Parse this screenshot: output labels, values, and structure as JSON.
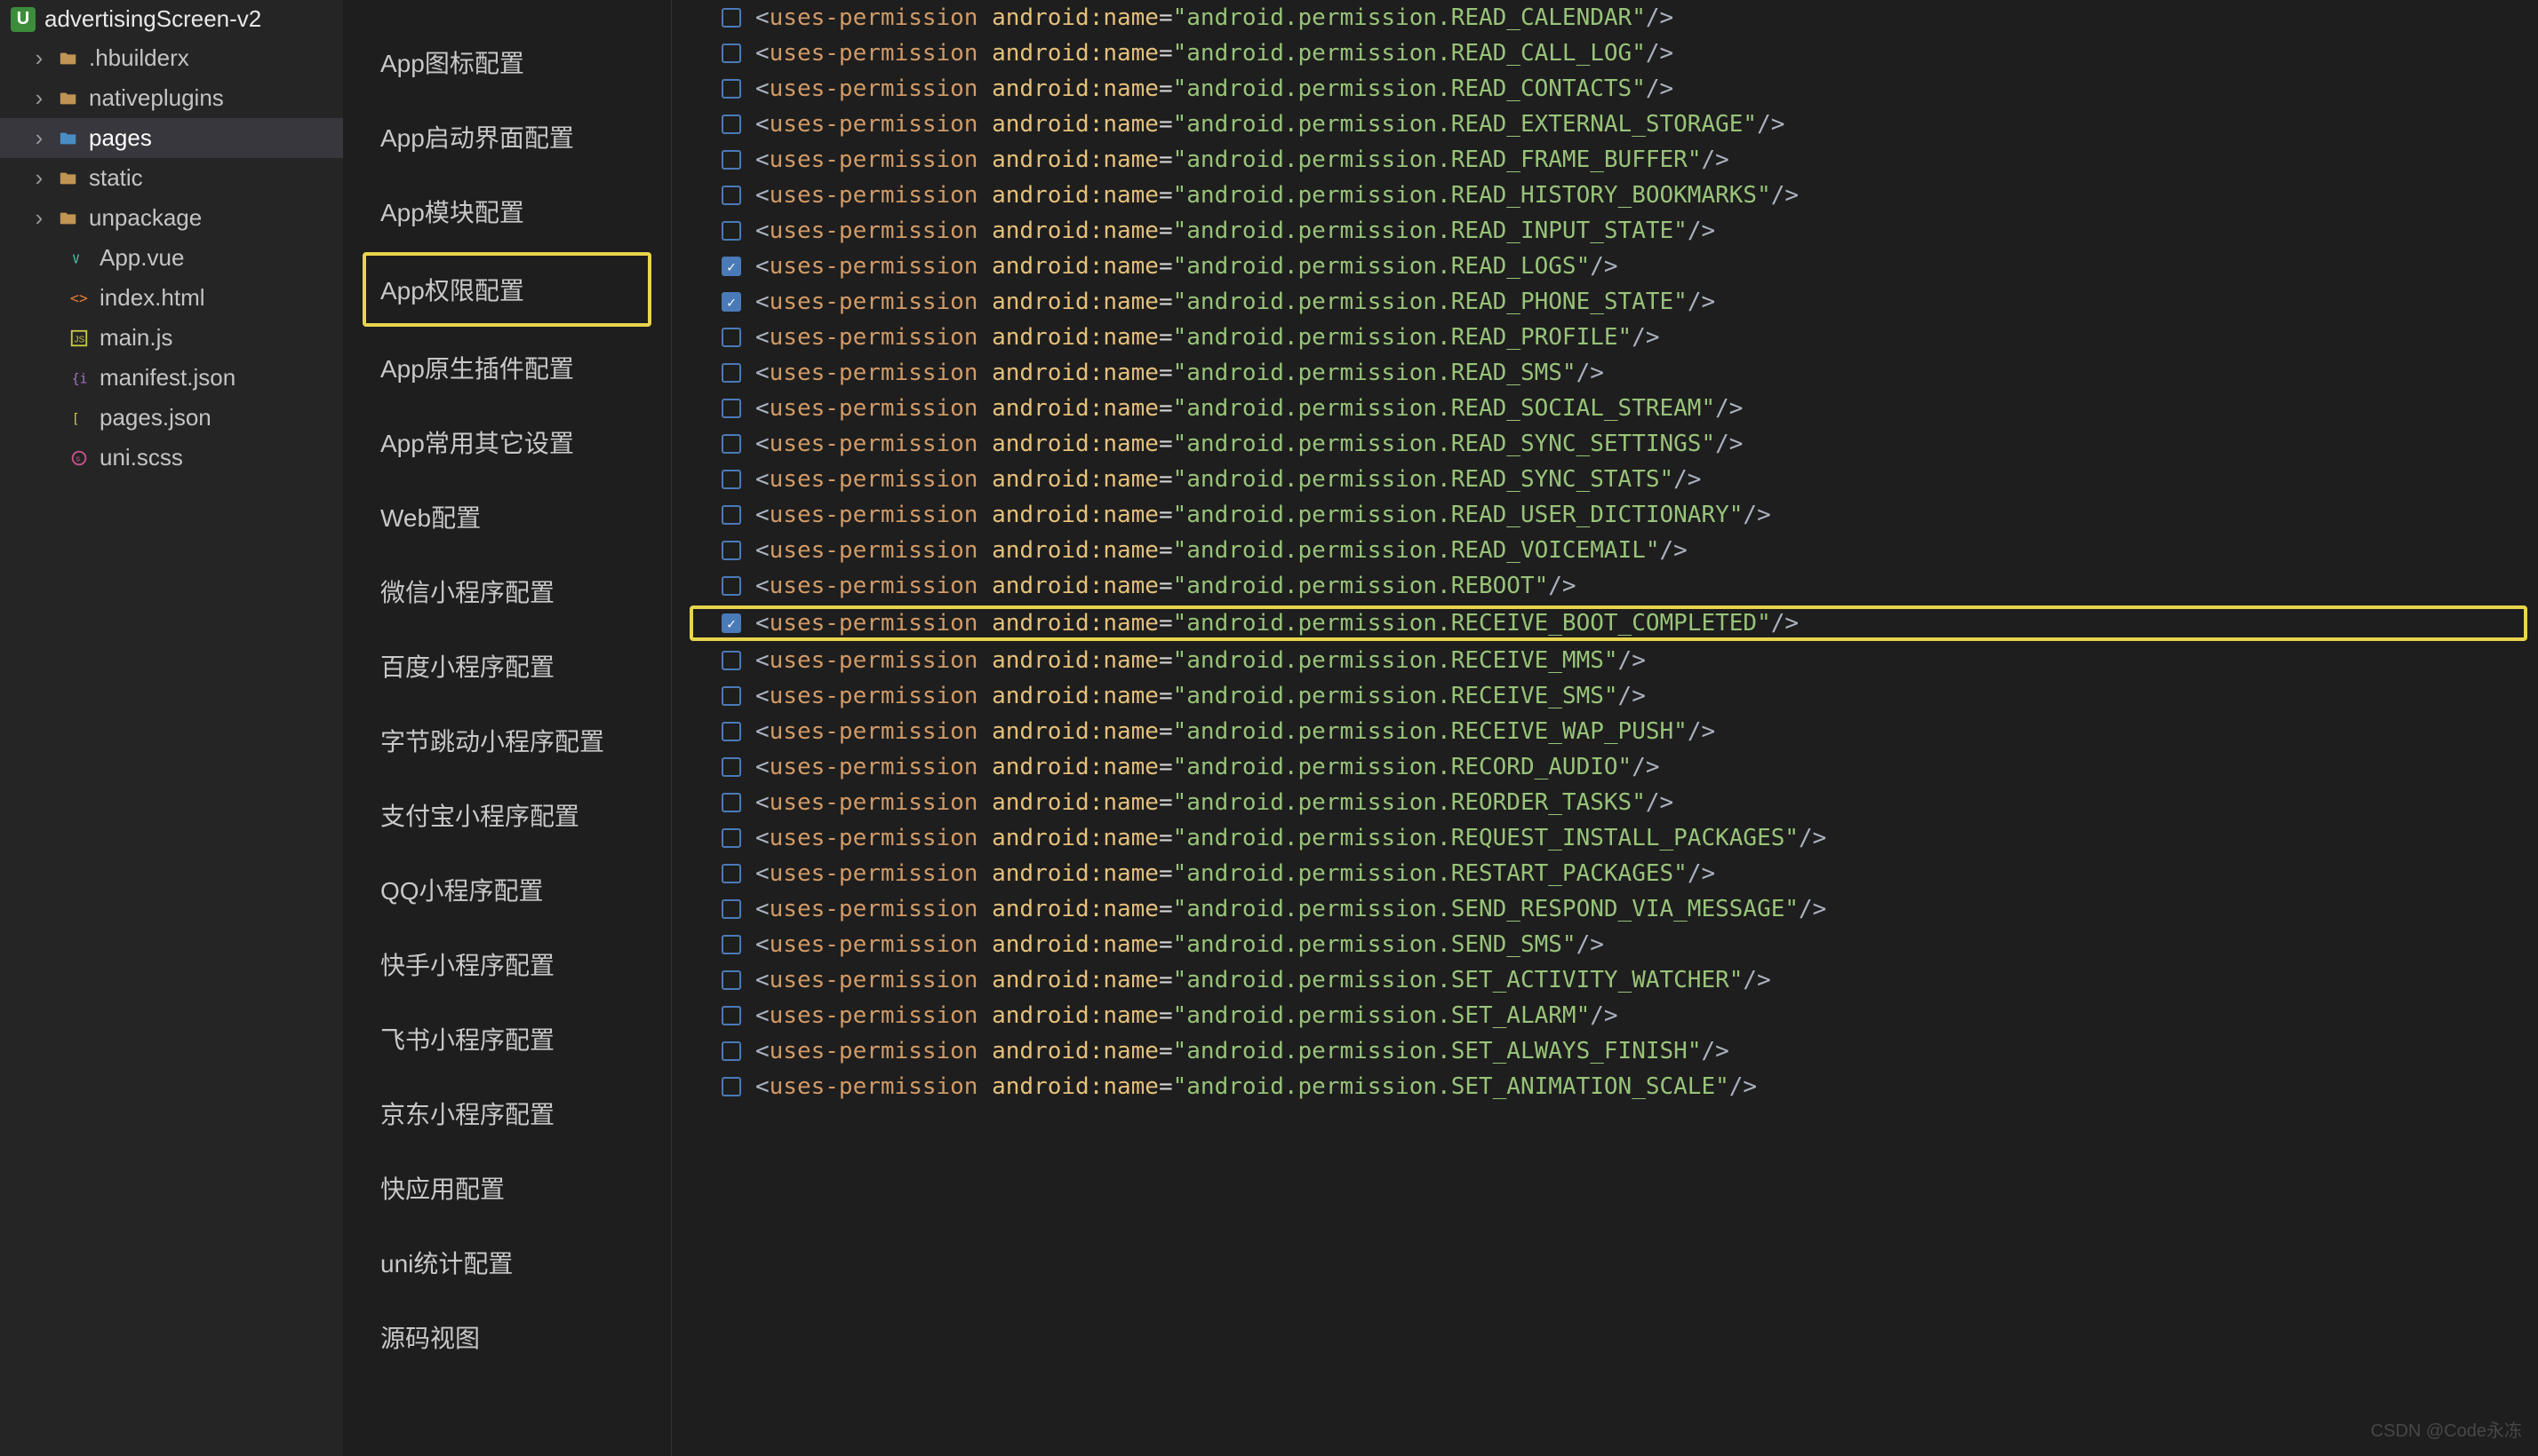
{
  "project": {
    "name": "advertisingScreen-v2"
  },
  "tree": [
    {
      "type": "folder",
      "label": ".hbuilderx",
      "icon": "folder"
    },
    {
      "type": "folder",
      "label": "nativeplugins",
      "icon": "folder"
    },
    {
      "type": "folder",
      "label": "pages",
      "icon": "folder-blue",
      "active": true
    },
    {
      "type": "folder",
      "label": "static",
      "icon": "folder"
    },
    {
      "type": "folder",
      "label": "unpackage",
      "icon": "folder"
    },
    {
      "type": "file",
      "label": "App.vue",
      "icon": "vue"
    },
    {
      "type": "file",
      "label": "index.html",
      "icon": "html"
    },
    {
      "type": "file",
      "label": "main.js",
      "icon": "js"
    },
    {
      "type": "file",
      "label": "manifest.json",
      "icon": "json-purple"
    },
    {
      "type": "file",
      "label": "pages.json",
      "icon": "json-yellow"
    },
    {
      "type": "file",
      "label": "uni.scss",
      "icon": "scss"
    }
  ],
  "nav": [
    {
      "label": "App图标配置"
    },
    {
      "label": "App启动界面配置"
    },
    {
      "label": "App模块配置"
    },
    {
      "label": "App权限配置",
      "highlight": true
    },
    {
      "label": "App原生插件配置"
    },
    {
      "label": "App常用其它设置"
    },
    {
      "label": "Web配置"
    },
    {
      "label": "微信小程序配置"
    },
    {
      "label": "百度小程序配置"
    },
    {
      "label": "字节跳动小程序配置"
    },
    {
      "label": "支付宝小程序配置"
    },
    {
      "label": "QQ小程序配置"
    },
    {
      "label": "快手小程序配置"
    },
    {
      "label": "飞书小程序配置"
    },
    {
      "label": "京东小程序配置"
    },
    {
      "label": "快应用配置"
    },
    {
      "label": "uni统计配置"
    },
    {
      "label": "源码视图"
    }
  ],
  "permissions": [
    {
      "name": "android.permission.READ_CALENDAR",
      "checked": false
    },
    {
      "name": "android.permission.READ_CALL_LOG",
      "checked": false
    },
    {
      "name": "android.permission.READ_CONTACTS",
      "checked": false
    },
    {
      "name": "android.permission.READ_EXTERNAL_STORAGE",
      "checked": false
    },
    {
      "name": "android.permission.READ_FRAME_BUFFER",
      "checked": false
    },
    {
      "name": "android.permission.READ_HISTORY_BOOKMARKS",
      "checked": false
    },
    {
      "name": "android.permission.READ_INPUT_STATE",
      "checked": false
    },
    {
      "name": "android.permission.READ_LOGS",
      "checked": true
    },
    {
      "name": "android.permission.READ_PHONE_STATE",
      "checked": true
    },
    {
      "name": "android.permission.READ_PROFILE",
      "checked": false
    },
    {
      "name": "android.permission.READ_SMS",
      "checked": false
    },
    {
      "name": "android.permission.READ_SOCIAL_STREAM",
      "checked": false
    },
    {
      "name": "android.permission.READ_SYNC_SETTINGS",
      "checked": false
    },
    {
      "name": "android.permission.READ_SYNC_STATS",
      "checked": false
    },
    {
      "name": "android.permission.READ_USER_DICTIONARY",
      "checked": false
    },
    {
      "name": "android.permission.READ_VOICEMAIL",
      "checked": false
    },
    {
      "name": "android.permission.REBOOT",
      "checked": false
    },
    {
      "name": "android.permission.RECEIVE_BOOT_COMPLETED",
      "checked": true,
      "highlight": true
    },
    {
      "name": "android.permission.RECEIVE_MMS",
      "checked": false
    },
    {
      "name": "android.permission.RECEIVE_SMS",
      "checked": false
    },
    {
      "name": "android.permission.RECEIVE_WAP_PUSH",
      "checked": false
    },
    {
      "name": "android.permission.RECORD_AUDIO",
      "checked": false
    },
    {
      "name": "android.permission.REORDER_TASKS",
      "checked": false
    },
    {
      "name": "android.permission.REQUEST_INSTALL_PACKAGES",
      "checked": false
    },
    {
      "name": "android.permission.RESTART_PACKAGES",
      "checked": false
    },
    {
      "name": "android.permission.SEND_RESPOND_VIA_MESSAGE",
      "checked": false
    },
    {
      "name": "android.permission.SEND_SMS",
      "checked": false
    },
    {
      "name": "android.permission.SET_ACTIVITY_WATCHER",
      "checked": false
    },
    {
      "name": "android.permission.SET_ALARM",
      "checked": false
    },
    {
      "name": "android.permission.SET_ALWAYS_FINISH",
      "checked": false
    },
    {
      "name": "android.permission.SET_ANIMATION_SCALE",
      "checked": false
    }
  ],
  "watermark": "CSDN @Code永冻"
}
